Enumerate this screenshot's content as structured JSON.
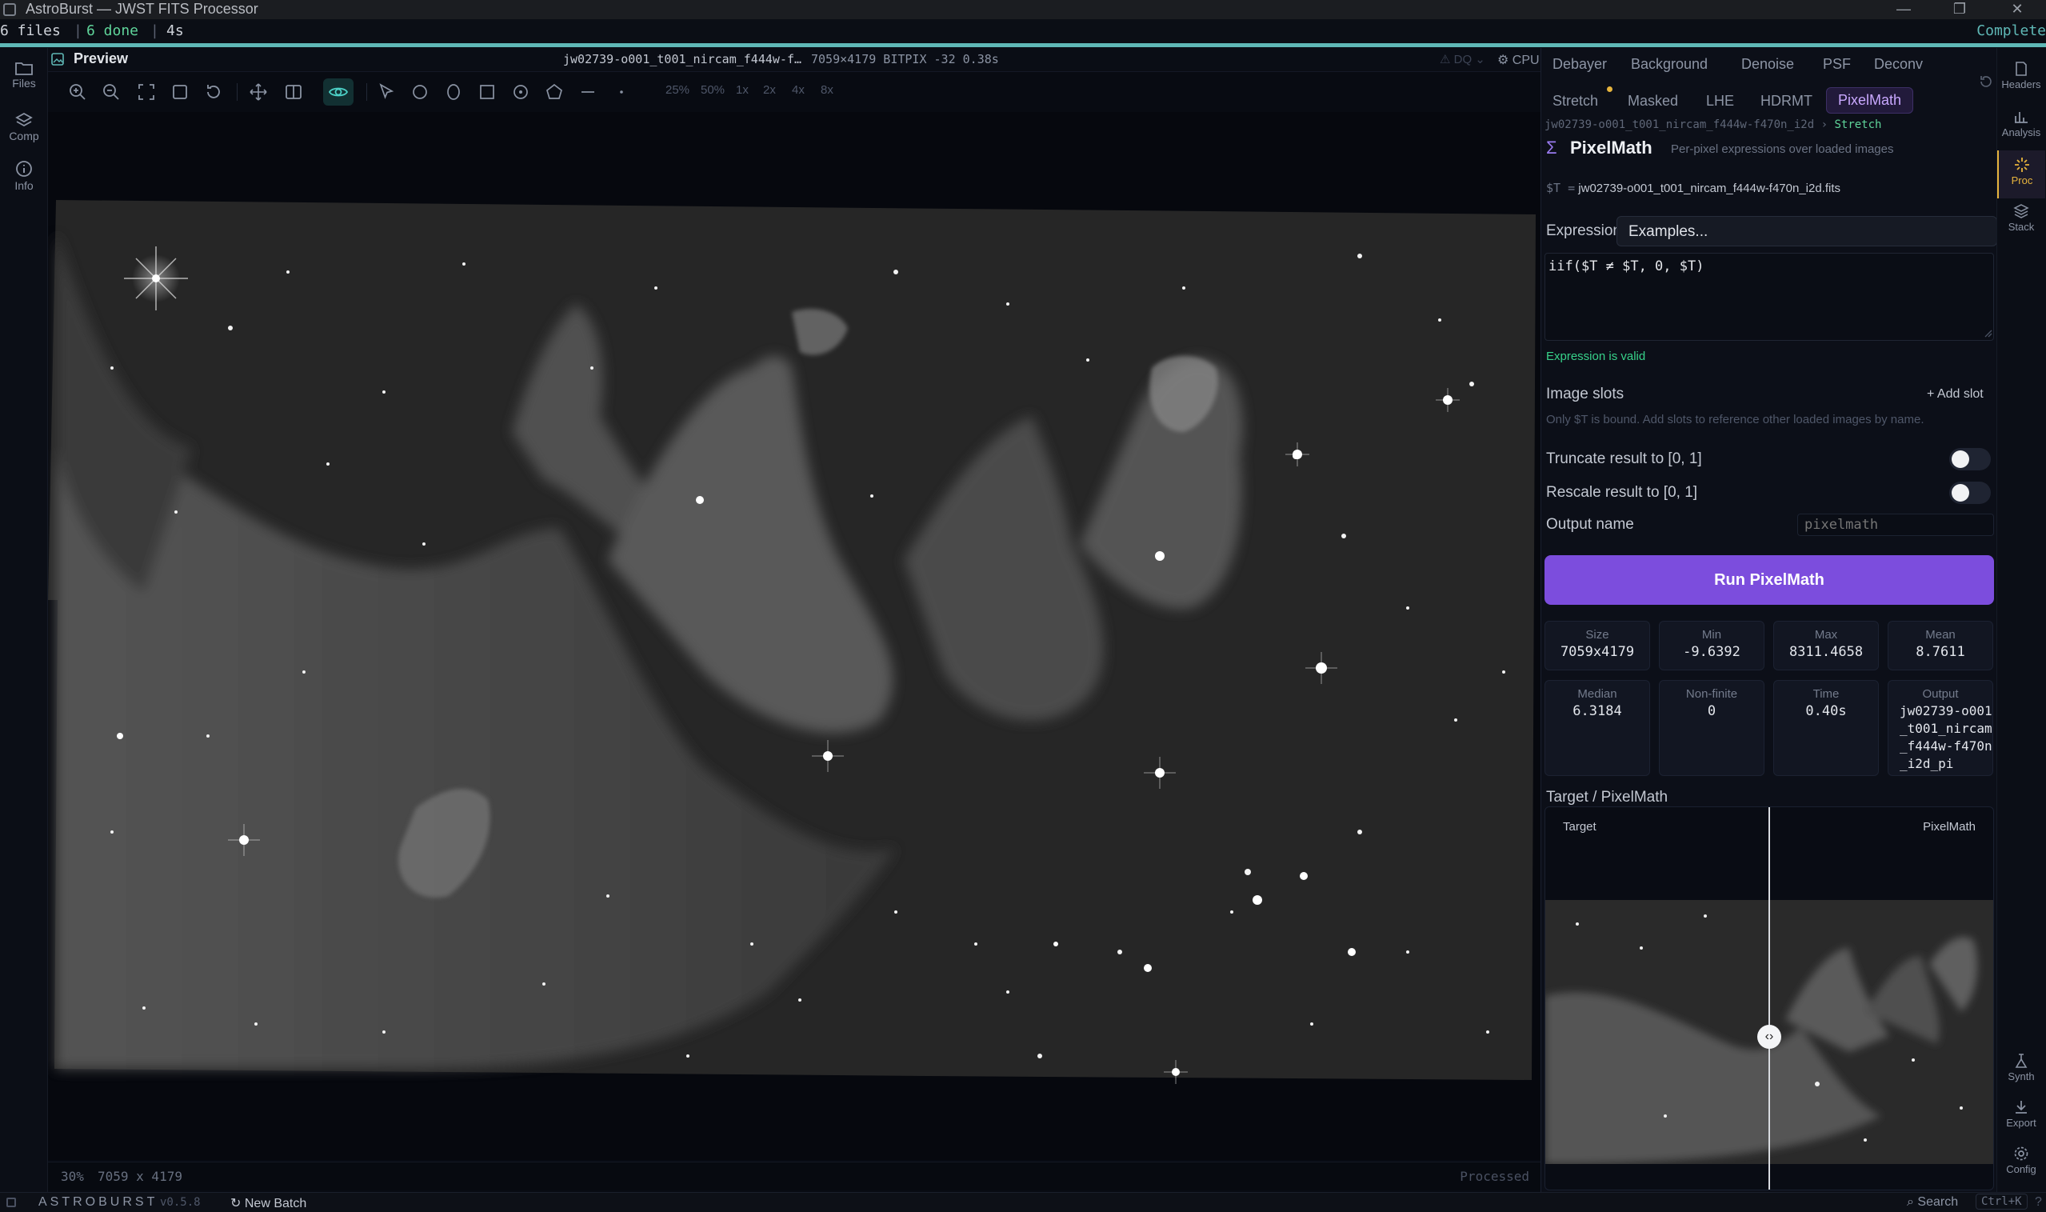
{
  "window": {
    "title": "AstroBurst — JWST FITS Processor",
    "min": "—",
    "max": "❐",
    "close": "✕"
  },
  "status": {
    "files": "6 files",
    "done": "6 done",
    "elapsed": "4s",
    "state": "Complete",
    "progress": 1.0
  },
  "left_rail": [
    {
      "label": "Files",
      "icon": "folder-icon"
    },
    {
      "label": "Comp",
      "icon": "layers-icon"
    },
    {
      "label": "Info",
      "icon": "info-icon"
    }
  ],
  "preview": {
    "title": "Preview",
    "filename": "jw02739-o001_t001_nircam_f444w-f…",
    "meta": "7059×4179 BITPIX -32 0.38s",
    "dq": "DQ",
    "cpu": "CPU",
    "zoom_presets": [
      "25%",
      "50%",
      "1x",
      "2x",
      "4x",
      "8x"
    ],
    "footer_zoom": "30%",
    "footer_dims": "7059 x 4179",
    "footer_state": "Processed"
  },
  "right_panel": {
    "tabs_row1": [
      "Debayer",
      "Background",
      "Denoise",
      "PSF",
      "Deconv"
    ],
    "tabs_row2": [
      "Stretch",
      "Masked",
      "LHE",
      "HDRMT",
      "PixelMath"
    ],
    "active_tab": "PixelMath",
    "breadcrumb_file": "jw02739-o001_t001_nircam_f444w-f470n_i2d",
    "breadcrumb_sep": "›",
    "breadcrumb_step": "Stretch",
    "title": "PixelMath",
    "subtitle": "Per-pixel expressions over loaded images",
    "binding_var": "$T =",
    "binding_file": "jw02739-o001_t001_nircam_f444w-f470n_i2d.fits",
    "expression_label": "Expression",
    "examples_label": "Examples...",
    "expression": "iif($T ≠ $T, 0, $T)",
    "valid_msg": "Expression is valid",
    "slots_label": "Image slots",
    "add_slot": "+ Add slot",
    "slots_hint": "Only $T is bound. Add slots to reference other loaded images by name.",
    "truncate_label": "Truncate result to [0, 1]",
    "truncate_on": false,
    "rescale_label": "Rescale result to [0, 1]",
    "rescale_on": false,
    "output_label": "Output name",
    "output_placeholder": "pixelmath",
    "run_label": "Run PixelMath",
    "stats": [
      {
        "k": "Size",
        "v": "7059x4179"
      },
      {
        "k": "Min",
        "v": "-9.6392"
      },
      {
        "k": "Max",
        "v": "8311.4658"
      },
      {
        "k": "Mean",
        "v": "8.7611"
      },
      {
        "k": "Median",
        "v": "6.3184"
      },
      {
        "k": "Non-finite",
        "v": "0"
      },
      {
        "k": "Time",
        "v": "0.40s"
      },
      {
        "k": "Output",
        "v": "jw02739-o001_t001_nircam_f444w-f470n_i2d_pi"
      }
    ],
    "compare_title": "Target / PixelMath",
    "compare_left": "Target",
    "compare_right": "PixelMath"
  },
  "right_rail": [
    {
      "label": "Headers",
      "icon": "headers-icon"
    },
    {
      "label": "Analysis",
      "icon": "analysis-icon"
    },
    {
      "label": "Proc",
      "icon": "proc-icon",
      "active": true
    },
    {
      "label": "Stack",
      "icon": "stack-icon"
    },
    {
      "label": "Synth",
      "icon": "synth-icon"
    },
    {
      "label": "Export",
      "icon": "export-icon"
    },
    {
      "label": "Config",
      "icon": "config-icon"
    }
  ],
  "footer": {
    "brand": "ASTROBURST",
    "version": "v0.5.8",
    "new_batch": "New Batch",
    "search": "Search",
    "shortcut": "Ctrl+K",
    "extra": "?"
  },
  "colors": {
    "accent": "#7c4ddd",
    "progress": "#5fb8b6",
    "valid": "#37d28a",
    "active_tab": "#c9a8ff"
  }
}
